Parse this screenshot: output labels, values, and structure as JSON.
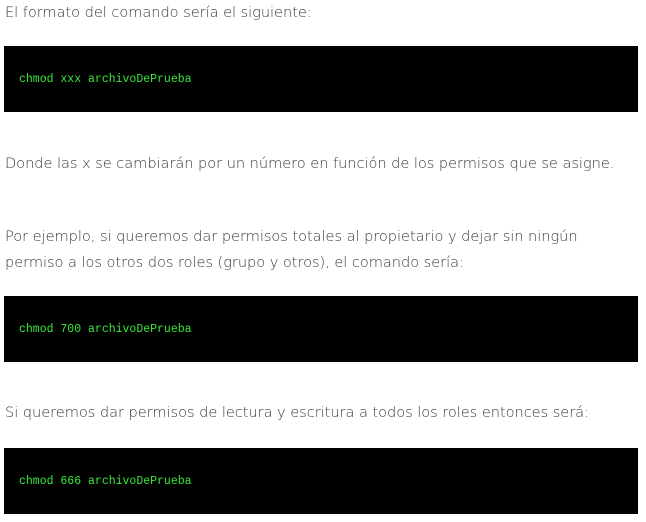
{
  "paragraphs": {
    "intro": "El formato del comando sería el siguiente:",
    "explanation": "Donde las x se cambiarán por un número en función de los permisos que se asigne.",
    "example_owner": "Por ejemplo, si queremos dar permisos totales al propietario y dejar sin ningún permiso a los otros dos roles (grupo y otros), el comando sería:",
    "example_all": "Si queremos dar permisos de lectura y escritura a todos los roles entonces será:"
  },
  "code_blocks": {
    "format": "chmod xxx archivoDePrueba",
    "owner_full": "chmod 700 archivoDePrueba",
    "read_write_all": "chmod 666 archivoDePrueba"
  },
  "colors": {
    "code_background": "#000000",
    "code_text": "#39e83a",
    "body_text": "#3b3b3b"
  }
}
